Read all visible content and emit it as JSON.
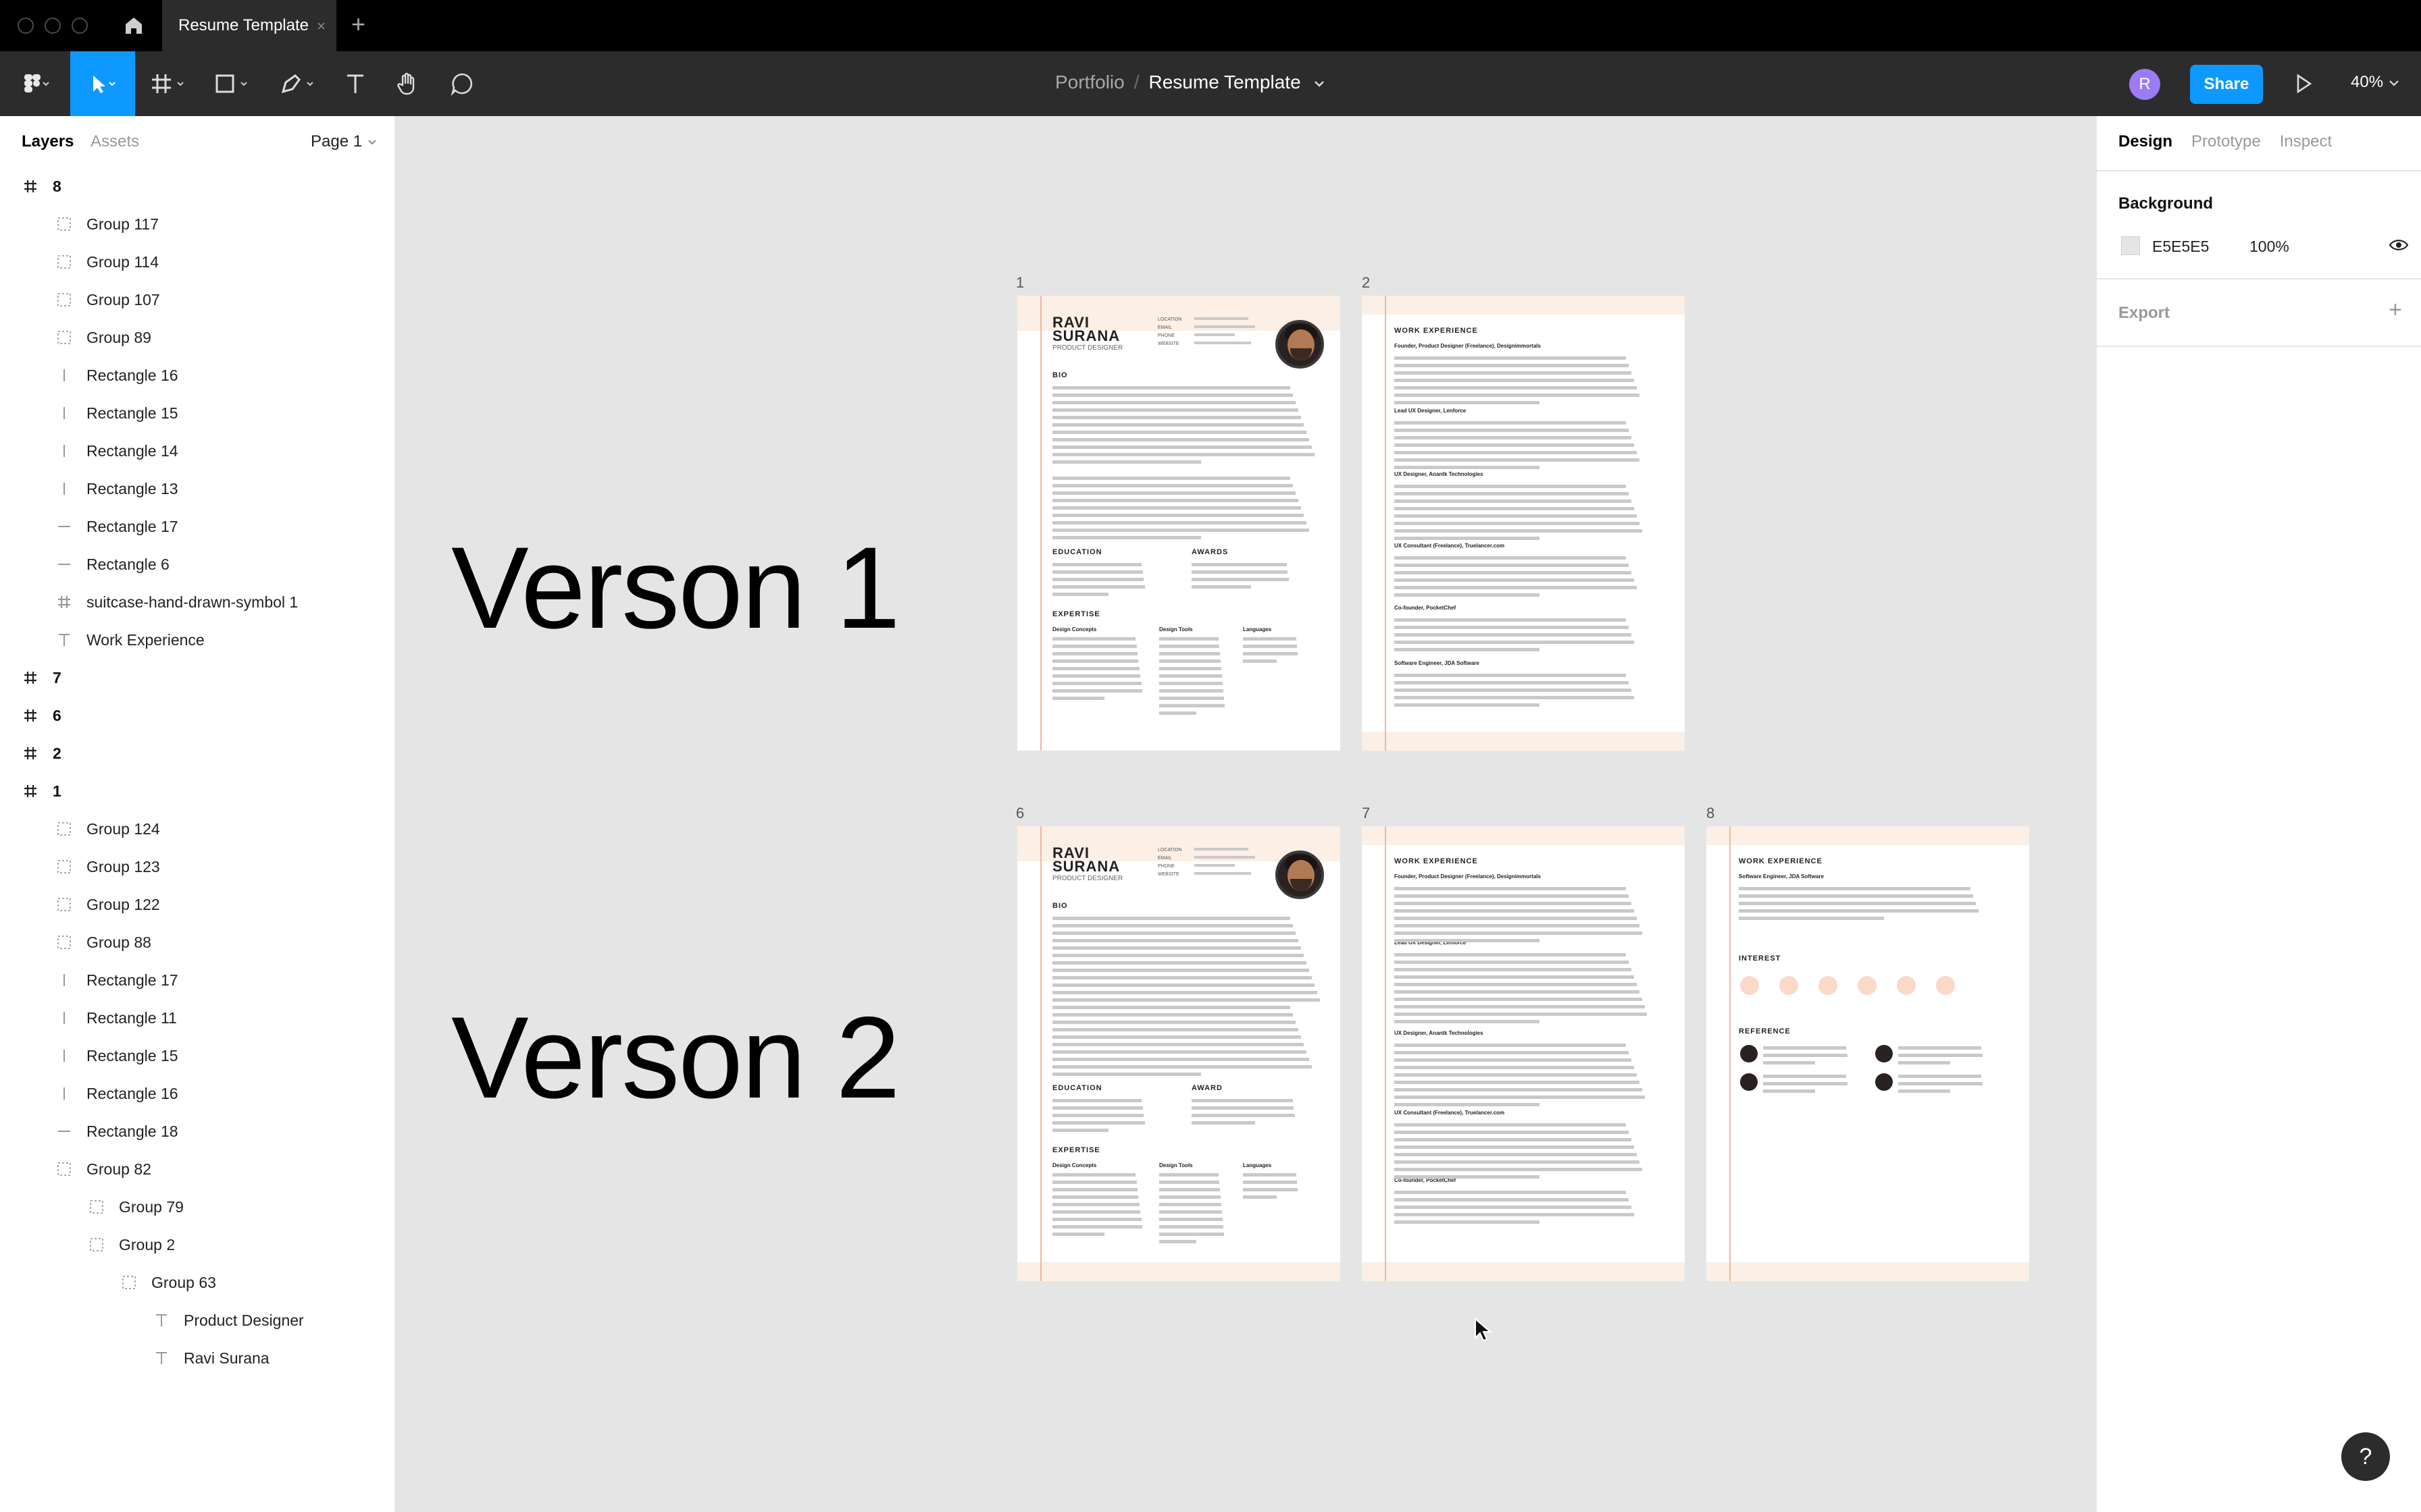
{
  "window": {
    "tab_title": "Resume Template",
    "tab_close": "×",
    "new_tab": "+"
  },
  "toolbar": {
    "breadcrumb_project": "Portfolio",
    "breadcrumb_sep": "/",
    "breadcrumb_file": "Resume Template",
    "avatar_initial": "R",
    "share_label": "Share",
    "zoom": "40%"
  },
  "left_panel": {
    "tab_layers": "Layers",
    "tab_assets": "Assets",
    "page_select": "Page 1",
    "layers": [
      {
        "name": "8",
        "type": "frame",
        "indent": 0
      },
      {
        "name": "Group 117",
        "type": "group",
        "indent": 1
      },
      {
        "name": "Group 114",
        "type": "group",
        "indent": 1
      },
      {
        "name": "Group 107",
        "type": "group",
        "indent": 1
      },
      {
        "name": "Group 89",
        "type": "group",
        "indent": 1
      },
      {
        "name": "Rectangle 16",
        "type": "vline",
        "indent": 1
      },
      {
        "name": "Rectangle 15",
        "type": "vline",
        "indent": 1
      },
      {
        "name": "Rectangle 14",
        "type": "vline",
        "indent": 1
      },
      {
        "name": "Rectangle 13",
        "type": "vline",
        "indent": 1
      },
      {
        "name": "Rectangle 17",
        "type": "hline",
        "indent": 1
      },
      {
        "name": "Rectangle 6",
        "type": "hline",
        "indent": 1
      },
      {
        "name": "suitcase-hand-drawn-symbol 1",
        "type": "frame-small",
        "indent": 1
      },
      {
        "name": "Work Experience",
        "type": "text",
        "indent": 1
      },
      {
        "name": "7",
        "type": "frame",
        "indent": 0
      },
      {
        "name": "6",
        "type": "frame",
        "indent": 0
      },
      {
        "name": "2",
        "type": "frame",
        "indent": 0
      },
      {
        "name": "1",
        "type": "frame",
        "indent": 0
      },
      {
        "name": "Group 124",
        "type": "group",
        "indent": 1
      },
      {
        "name": "Group 123",
        "type": "group",
        "indent": 1
      },
      {
        "name": "Group 122",
        "type": "group",
        "indent": 1
      },
      {
        "name": "Group 88",
        "type": "group",
        "indent": 1
      },
      {
        "name": "Rectangle 17",
        "type": "vline",
        "indent": 1
      },
      {
        "name": "Rectangle 11",
        "type": "vline",
        "indent": 1
      },
      {
        "name": "Rectangle 15",
        "type": "vline",
        "indent": 1
      },
      {
        "name": "Rectangle 16",
        "type": "vline",
        "indent": 1
      },
      {
        "name": "Rectangle 18",
        "type": "hline",
        "indent": 1
      },
      {
        "name": "Group 82",
        "type": "group",
        "indent": 1
      },
      {
        "name": "Group 79",
        "type": "group",
        "indent": 2
      },
      {
        "name": "Group 2",
        "type": "group",
        "indent": 2
      },
      {
        "name": "Group 63",
        "type": "group",
        "indent": 3
      },
      {
        "name": "Product Designer",
        "type": "text",
        "indent": 4
      },
      {
        "name": "Ravi Surana",
        "type": "text",
        "indent": 4
      }
    ]
  },
  "right_panel": {
    "tab_design": "Design",
    "tab_prototype": "Prototype",
    "tab_inspect": "Inspect",
    "background_label": "Background",
    "background_hex": "E5E5E5",
    "background_opacity": "100%",
    "export_label": "Export",
    "export_add": "+"
  },
  "canvas": {
    "version1": "Verson 1",
    "version2": "Verson 2",
    "frames": {
      "f1": "1",
      "f2": "2",
      "f6": "6",
      "f7": "7",
      "f8": "8"
    },
    "resume": {
      "name_first": "RAVI",
      "name_last": "SURANA",
      "role": "PRODUCT DESIGNER",
      "contact": "LOCATION\nEMAIL\nPHONE\nWEBSITE",
      "bio": "BIO",
      "education": "EDUCATION",
      "awards": "AWARDS",
      "award": "AWARD",
      "expertise": "EXPERTISE",
      "design_concepts": "Design Concepts",
      "design_tools": "Design Tools",
      "languages": "Languages",
      "work_experience": "WORK EXPERIENCE",
      "job1": "Founder, Product Designer (Freelance), Designimmortals",
      "job2": "Lead UX Designer, Lenforce",
      "job3": "UX Designer, Anantk Technologies",
      "job4": "UX Consultant (Freelance), Truelancer.com",
      "job5": "Co-founder, PocketChef",
      "job6": "Software Engineer, JDA Software",
      "interest": "INTEREST",
      "reference": "REFERENCE"
    }
  },
  "help": "?"
}
